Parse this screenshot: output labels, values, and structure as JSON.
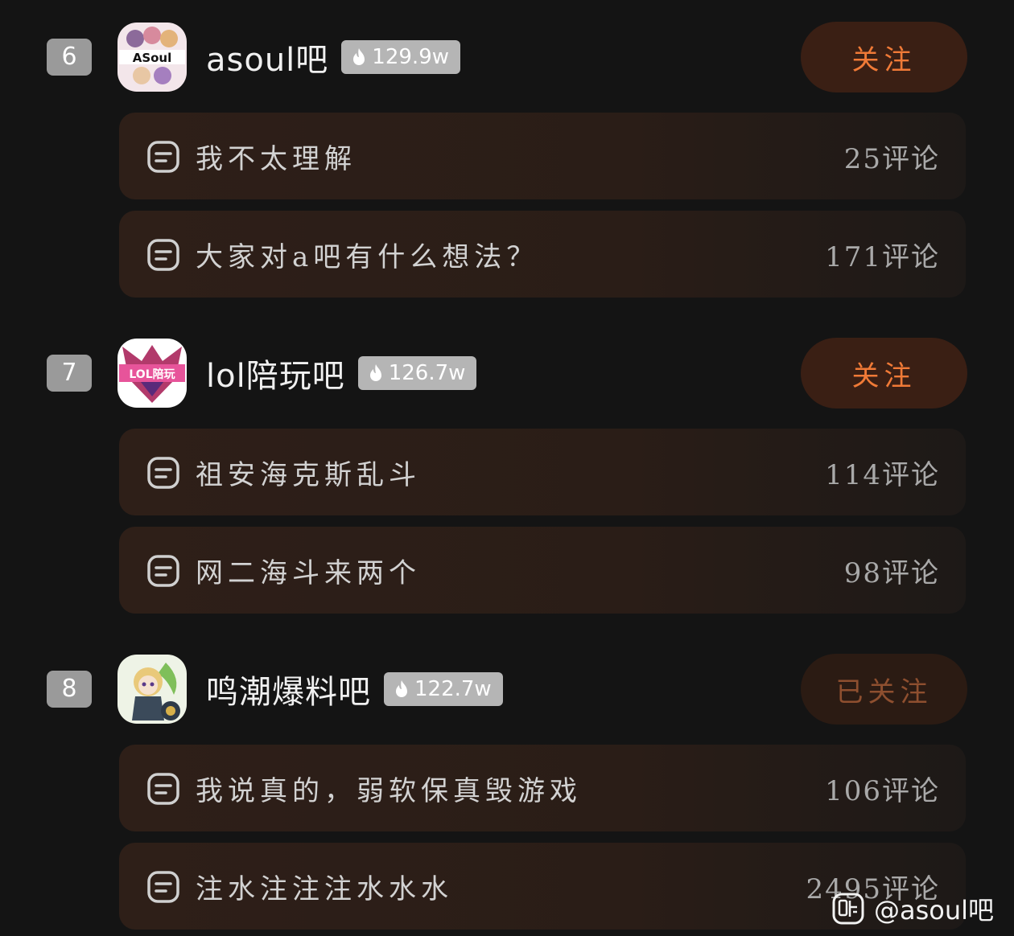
{
  "forums": [
    {
      "rank": "6",
      "name": "asoul吧",
      "heat": "129.9w",
      "avatar_text": "ASoul",
      "follow_label": "关注",
      "followed": false,
      "posts": [
        {
          "title": "我不太理解",
          "comments": "25评论"
        },
        {
          "title": "大家对a吧有什么想法？",
          "comments": "171评论"
        }
      ]
    },
    {
      "rank": "7",
      "name": "lol陪玩吧",
      "heat": "126.7w",
      "avatar_text": "LOL陪玩",
      "follow_label": "关注",
      "followed": false,
      "posts": [
        {
          "title": "祖安海克斯乱斗",
          "comments": "114评论"
        },
        {
          "title": "网二海斗来两个",
          "comments": "98评论"
        }
      ]
    },
    {
      "rank": "8",
      "name": "鸣潮爆料吧",
      "heat": "122.7w",
      "avatar_text": "",
      "follow_label": "已关注",
      "followed": true,
      "posts": [
        {
          "title": "我说真的，弱软保真毁游戏",
          "comments": "106评论"
        },
        {
          "title": "注水注注注水水水",
          "comments": "2495评论"
        }
      ]
    }
  ],
  "watermark": {
    "text": "@asoul吧",
    "icon": "tieba-logo-icon"
  },
  "icons": {
    "heat": "flame-icon",
    "post": "post-message-icon"
  },
  "colors": {
    "background": "#141414",
    "follow_text": "#f07a37",
    "followed_text": "#8e4f2f",
    "badge": "#b5b5b5",
    "rank_badge": "#9a9a9a"
  }
}
